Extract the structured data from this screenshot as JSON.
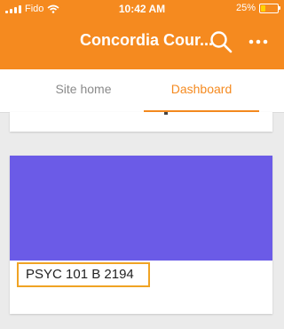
{
  "status_bar": {
    "carrier": "Fido",
    "time": "10:42 AM",
    "battery_percent": "25%",
    "battery_level": 0.25,
    "icons": [
      "signal-icon",
      "wifi-icon",
      "battery-icon"
    ]
  },
  "app_bar": {
    "title": "Concordia Cour...",
    "background": "#f58a1f",
    "icons": [
      "search-icon",
      "more-icon"
    ]
  },
  "tabs": [
    {
      "label": "Site home",
      "active": false
    },
    {
      "label": "Dashboard",
      "active": true
    }
  ],
  "courses": [
    {
      "name": "PSYC 101 B 2194",
      "image_color": "#6b5be7"
    }
  ],
  "colors": {
    "accent": "#f58a1f",
    "highlight_border": "#f0a324",
    "background": "#ebebeb"
  }
}
